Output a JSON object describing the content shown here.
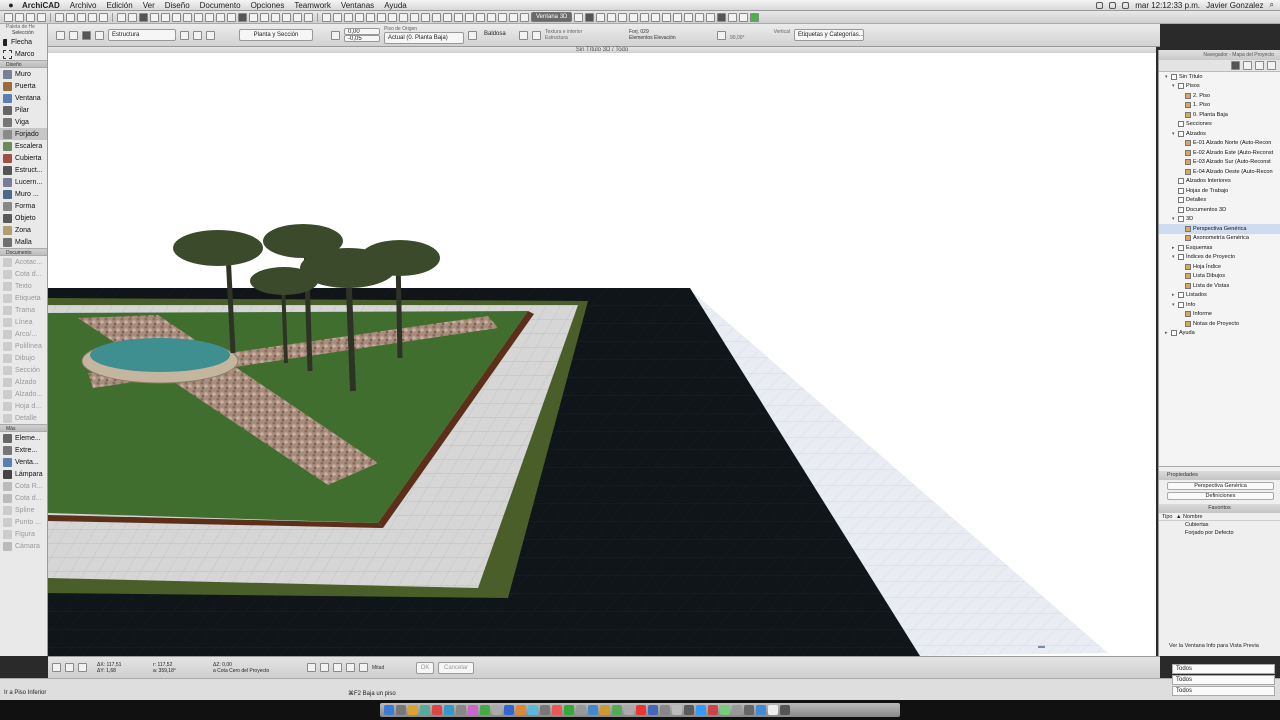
{
  "menubar": {
    "app": "ArchiCAD",
    "items": [
      "Archivo",
      "Edición",
      "Ver",
      "Diseño",
      "Documento",
      "Opciones",
      "Teamwork",
      "Ventanas",
      "Ayuda"
    ],
    "clock": "mar 12:12:33 p.m.",
    "user": "Javier Gonzalez"
  },
  "toolbar1": {
    "view_3d_button": "Ventana 3D"
  },
  "toolbar2": {
    "mode": "Estructura",
    "view_label": "Planta y Sección",
    "origin_label": "Piso de Origen",
    "v1": "0,00",
    "v2": "-0,05",
    "story_select": "Actual (0. Planta Baja)",
    "tile_label": "Baldosa",
    "hint1": "Textura e interior",
    "hint2": "Estructura",
    "layer_label": "Forj. 029",
    "element_label": "Elementos Elevación",
    "vertical_label": "Vertical",
    "angle_val": "90,00°",
    "tags_label": "Etiquetas y Categorías..."
  },
  "toolbox": {
    "header": "Paleta de He",
    "selection": "Selección",
    "sel_tools": [
      "Flecha",
      "Marco"
    ],
    "design_label": "Diseño",
    "design_tools": [
      "Muro",
      "Puerta",
      "Ventana",
      "Pilar",
      "Viga",
      "Forjado",
      "Escalera",
      "Cubierta",
      "Estruct...",
      "Lucern...",
      "Muro ...",
      "Forma",
      "Objeto",
      "Zona",
      "Malla"
    ],
    "doc_label": "Documento",
    "doc_tools": [
      "Acotac...",
      "Cota d...",
      "Texto",
      "Etiqueta",
      "Trama",
      "Línea",
      "Arco/...",
      "Polilínea",
      "Dibujo",
      "Sección",
      "Alzado",
      "Alzado...",
      "Hoja d...",
      "Detalle"
    ],
    "more_label": "Más",
    "more_tools": [
      "Eleme...",
      "Extre...",
      "Venta...",
      "Lámpara",
      "Cota R...",
      "Cota d...",
      "Spline",
      "Punto ...",
      "Figura",
      "Cámara"
    ]
  },
  "viewport": {
    "title": "Sin Título 3D / Todo"
  },
  "navigator": {
    "title": "Navegador - Mapa del Proyecto",
    "tree": [
      {
        "label": "Sin Título",
        "level": 0,
        "tri": "▾"
      },
      {
        "label": "Pisos",
        "level": 1,
        "tri": "▾"
      },
      {
        "label": "2. Piso",
        "level": 2,
        "tri": ""
      },
      {
        "label": "1. Piso",
        "level": 2,
        "tri": ""
      },
      {
        "label": "0. Planta Baja",
        "level": 2,
        "tri": ""
      },
      {
        "label": "Secciones",
        "level": 1,
        "tri": ""
      },
      {
        "label": "Alzados",
        "level": 1,
        "tri": "▾"
      },
      {
        "label": "E-01 Alzado Norte (Auto-Recon",
        "level": 2,
        "tri": ""
      },
      {
        "label": "E-02 Alzado Este (Auto-Reconst",
        "level": 2,
        "tri": ""
      },
      {
        "label": "E-03 Alzado Sur (Auto-Reconst",
        "level": 2,
        "tri": ""
      },
      {
        "label": "E-04 Alzado Oeste (Auto-Recon",
        "level": 2,
        "tri": ""
      },
      {
        "label": "Alzados Interiores",
        "level": 1,
        "tri": ""
      },
      {
        "label": "Hojas de Trabajo",
        "level": 1,
        "tri": ""
      },
      {
        "label": "Detalles",
        "level": 1,
        "tri": ""
      },
      {
        "label": "Documentos 3D",
        "level": 1,
        "tri": ""
      },
      {
        "label": "3D",
        "level": 1,
        "tri": "▾"
      },
      {
        "label": "Perspectiva Genérica",
        "level": 2,
        "tri": "",
        "sel": true
      },
      {
        "label": "Axonometría Genérica",
        "level": 2,
        "tri": ""
      },
      {
        "label": "Esquemas",
        "level": 1,
        "tri": "▸"
      },
      {
        "label": "Índices de Proyecto",
        "level": 1,
        "tri": "▾"
      },
      {
        "label": "Hoja Índice",
        "level": 2,
        "tri": ""
      },
      {
        "label": "Lista Dibujos",
        "level": 2,
        "tri": ""
      },
      {
        "label": "Lista de Vistas",
        "level": 2,
        "tri": ""
      },
      {
        "label": "Listados",
        "level": 1,
        "tri": "▸"
      },
      {
        "label": "Info",
        "level": 1,
        "tri": "▾"
      },
      {
        "label": "Informe",
        "level": 2,
        "tri": ""
      },
      {
        "label": "Notas de Proyecto",
        "level": 2,
        "tri": ""
      },
      {
        "label": "Ayuda",
        "level": 0,
        "tri": "▸"
      }
    ]
  },
  "properties": {
    "header": "Propiedades",
    "name": "Perspectiva Genérica",
    "definitions": "Definiciones",
    "favorites": "Favoritos",
    "col_type": "Tipo",
    "col_name": "▲ Nombre",
    "fav_items": [
      "Cubiertas",
      "Forjado por Defecto"
    ],
    "info_note": "Ver la Ventana Info para Vista Previa"
  },
  "statusbar": {
    "dx": "ΔX: 117,51",
    "dy": "ΔY: 1,68",
    "r": "r: 117,52",
    "a": "a: 359,18°",
    "dz": "ΔZ: 0,00",
    "ref": "a Cota Cero del Proyecto",
    "mitad": "Mitad",
    "ok": "OK",
    "cancel": "Cancelar"
  },
  "bottom": {
    "hint": "Ir a Piso Inferior",
    "shortcut": "⌘F2 Baja un piso",
    "filters": [
      "Todos",
      "Todos",
      "Todos"
    ]
  },
  "colors": {
    "grass": "#3f6e2e",
    "pavement": "#d9d9d9",
    "dark_slab": "#0f1518",
    "water": "#3f8f90"
  }
}
